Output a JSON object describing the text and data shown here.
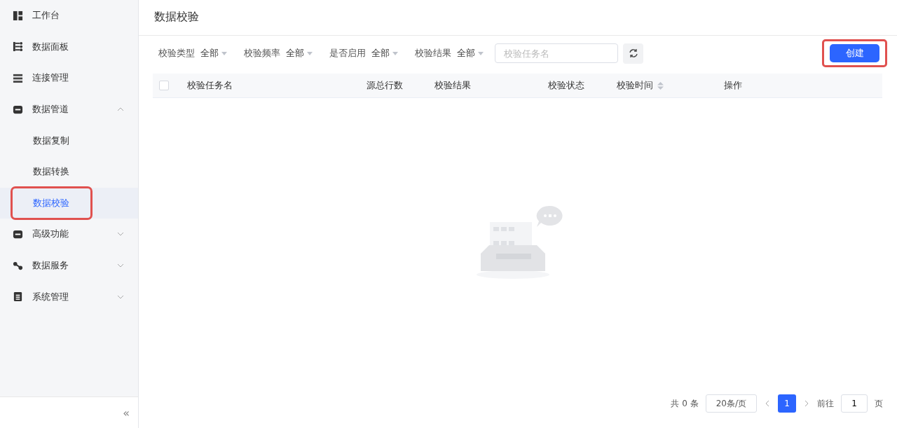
{
  "sidebar": {
    "items": [
      {
        "label": "工作台",
        "selected": false
      },
      {
        "label": "数据面板",
        "selected": false
      },
      {
        "label": "连接管理",
        "selected": false
      },
      {
        "label": "数据管道",
        "selected": false,
        "expanded": true,
        "children": [
          {
            "label": "数据复制",
            "selected": false,
            "highlighted": false
          },
          {
            "label": "数据转换",
            "selected": false,
            "highlighted": false
          },
          {
            "label": "数据校验",
            "selected": true,
            "highlighted": true
          }
        ]
      },
      {
        "label": "高级功能",
        "selected": false,
        "expanded": false
      },
      {
        "label": "数据服务",
        "selected": false,
        "expanded": false
      },
      {
        "label": "系统管理",
        "selected": false,
        "expanded": false
      }
    ],
    "collapse": "«"
  },
  "page_title": "数据校验",
  "filters": [
    {
      "label": "校验类型",
      "value": "全部"
    },
    {
      "label": "校验频率",
      "value": "全部"
    },
    {
      "label": "是否启用",
      "value": "全部"
    },
    {
      "label": "校验结果",
      "value": "全部"
    }
  ],
  "search": {
    "placeholder": "校验任务名"
  },
  "create_button": {
    "label": "创建",
    "highlighted": true
  },
  "table": {
    "columns": [
      {
        "label": "校验任务名",
        "sortable": false
      },
      {
        "label": "源总行数",
        "sortable": false
      },
      {
        "label": "校验结果",
        "sortable": false
      },
      {
        "label": "校验状态",
        "sortable": false
      },
      {
        "label": "校验时间",
        "sortable": true
      },
      {
        "label": "操作",
        "sortable": false
      }
    ],
    "select_all": {
      "checked": false
    }
  },
  "pagination": {
    "total": "共 0 条",
    "page_size": "20条/页",
    "pages": [
      {
        "label": "1",
        "selected": true
      }
    ],
    "jump_label": "前往",
    "jump_value": "1",
    "jump_suffix": "页"
  }
}
